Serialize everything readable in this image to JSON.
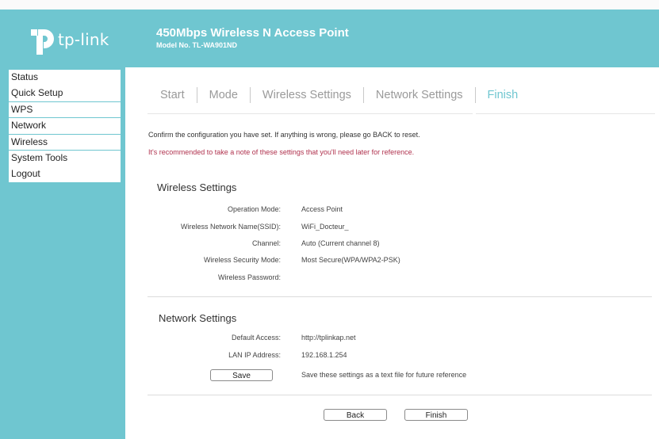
{
  "header": {
    "brand": "tp-link",
    "title": "450Mbps Wireless N Access Point",
    "model": "Model No. TL-WA901ND"
  },
  "sidebar": {
    "items": [
      {
        "label": "Status"
      },
      {
        "label": "Quick Setup"
      },
      {
        "label": "WPS"
      },
      {
        "label": "Network"
      },
      {
        "label": "Wireless"
      },
      {
        "label": "System Tools"
      },
      {
        "label": "Logout"
      }
    ]
  },
  "steps": [
    {
      "label": "Start"
    },
    {
      "label": "Mode"
    },
    {
      "label": "Wireless Settings"
    },
    {
      "label": "Network Settings"
    },
    {
      "label": "Finish"
    }
  ],
  "messages": {
    "confirm": "Confirm the configuration you have set. If anything is wrong, please go BACK to reset.",
    "note": "It's recommended to take a note of these settings that you'll need later for reference."
  },
  "wireless": {
    "title": "Wireless Settings",
    "rows": [
      {
        "label": "Operation Mode:",
        "value": "Access Point"
      },
      {
        "label": "Wireless Network Name(SSID):",
        "value": "WiFi_Docteur_"
      },
      {
        "label": "Channel:",
        "value": "Auto (Current channel 8)"
      },
      {
        "label": "Wireless Security Mode:",
        "value": "Most Secure(WPA/WPA2-PSK)"
      },
      {
        "label": "Wireless Password:",
        "value": ""
      }
    ]
  },
  "network": {
    "title": "Network Settings",
    "rows": [
      {
        "label": "Default Access:",
        "value": "http://tplinkap.net"
      },
      {
        "label": "LAN IP Address:",
        "value": "192.168.1.254"
      }
    ],
    "save_label": "Save",
    "save_hint": "Save these settings as a text file for future reference"
  },
  "buttons": {
    "back": "Back",
    "finish": "Finish"
  },
  "colors": {
    "brand": "#6fc6d0",
    "warning": "#b0324e"
  }
}
